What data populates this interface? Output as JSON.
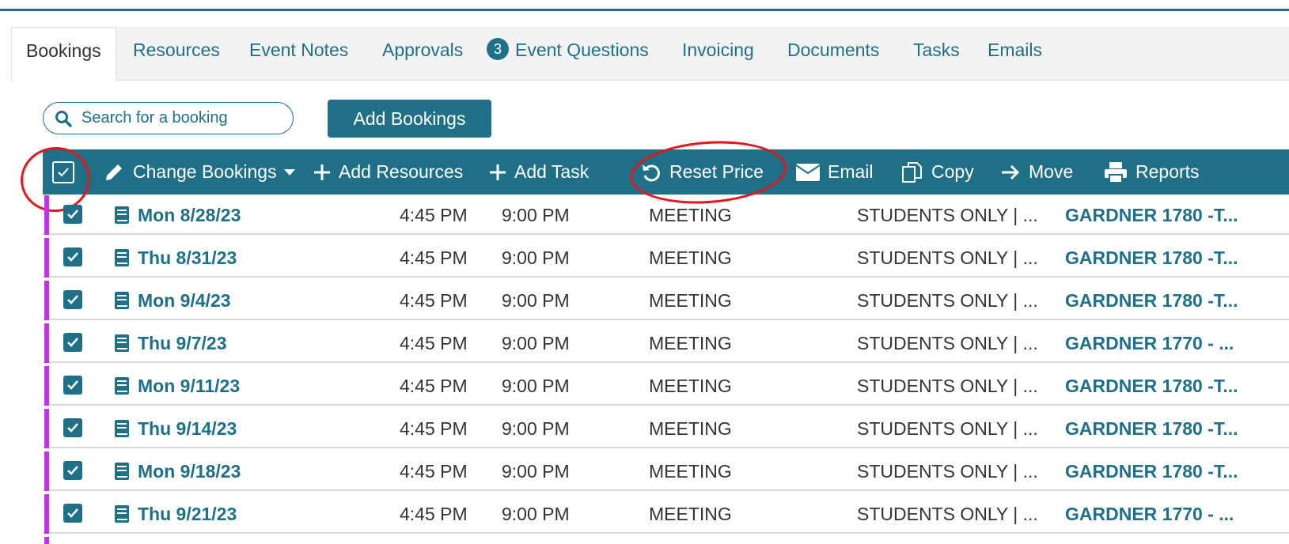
{
  "tabs": [
    {
      "label": "Bookings",
      "active": true
    },
    {
      "label": "Resources"
    },
    {
      "label": "Event Notes"
    },
    {
      "label": "Approvals"
    },
    {
      "label": "Event Questions",
      "badge": "3"
    },
    {
      "label": "Invoicing"
    },
    {
      "label": "Documents"
    },
    {
      "label": "Tasks"
    },
    {
      "label": "Emails"
    }
  ],
  "search": {
    "placeholder": "Search for a booking",
    "icon": "search-icon"
  },
  "add_bookings_label": "Add Bookings",
  "toolbar": {
    "select_all_checked": true,
    "change_bookings": "Change Bookings",
    "add_resources": "Add Resources",
    "add_task": "Add Task",
    "reset_price": "Reset Price",
    "email": "Email",
    "copy": "Copy",
    "move": "Move",
    "reports": "Reports"
  },
  "bookings": [
    {
      "date": "Mon 8/28/23",
      "start": "4:45 PM",
      "end": "9:00 PM",
      "type": "MEETING",
      "group": "STUDENTS ONLY | ...",
      "room": "GARDNER 1780 -T..."
    },
    {
      "date": "Thu 8/31/23",
      "start": "4:45 PM",
      "end": "9:00 PM",
      "type": "MEETING",
      "group": "STUDENTS ONLY | ...",
      "room": "GARDNER 1780 -T..."
    },
    {
      "date": "Mon 9/4/23",
      "start": "4:45 PM",
      "end": "9:00 PM",
      "type": "MEETING",
      "group": "STUDENTS ONLY | ...",
      "room": "GARDNER 1780 -T..."
    },
    {
      "date": "Thu 9/7/23",
      "start": "4:45 PM",
      "end": "9:00 PM",
      "type": "MEETING",
      "group": "STUDENTS ONLY | ...",
      "room": "GARDNER 1770 - ..."
    },
    {
      "date": "Mon 9/11/23",
      "start": "4:45 PM",
      "end": "9:00 PM",
      "type": "MEETING",
      "group": "STUDENTS ONLY | ...",
      "room": "GARDNER 1780 -T..."
    },
    {
      "date": "Thu 9/14/23",
      "start": "4:45 PM",
      "end": "9:00 PM",
      "type": "MEETING",
      "group": "STUDENTS ONLY | ...",
      "room": "GARDNER 1780 -T..."
    },
    {
      "date": "Mon 9/18/23",
      "start": "4:45 PM",
      "end": "9:00 PM",
      "type": "MEETING",
      "group": "STUDENTS ONLY | ...",
      "room": "GARDNER 1780 -T..."
    },
    {
      "date": "Thu 9/21/23",
      "start": "4:45 PM",
      "end": "9:00 PM",
      "type": "MEETING",
      "group": "STUDENTS ONLY | ...",
      "room": "GARDNER 1770 - ..."
    }
  ],
  "colors": {
    "accent": "#1f6f86",
    "row_marker": "#c433e0",
    "annotation": "#e8141b"
  }
}
